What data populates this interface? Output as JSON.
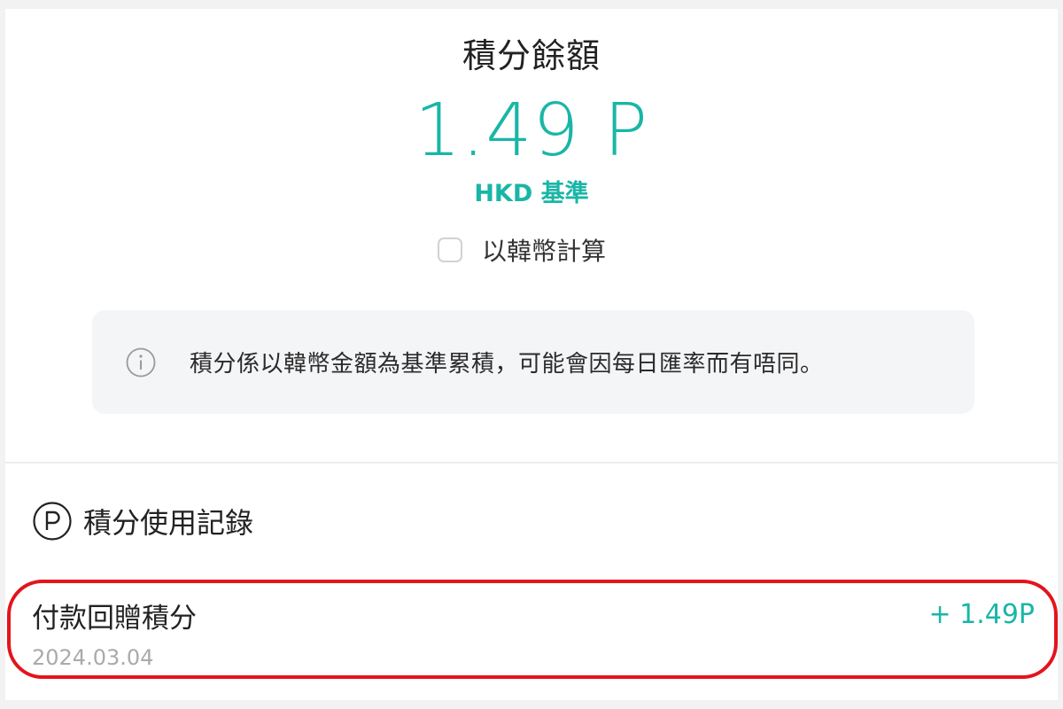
{
  "balance": {
    "title": "積分餘額",
    "amount": "1.49 P",
    "basis": "HKD 基準",
    "krw_toggle_label": "以韓幣計算",
    "krw_toggle_checked": false
  },
  "notice": {
    "icon": "info-icon",
    "text": "積分係以韓幣金額為基準累積，可能會因每日匯率而有唔同。"
  },
  "history": {
    "icon": "points-p-icon",
    "label": "積分使用記錄",
    "records": [
      {
        "title": "付款回贈積分",
        "amount": "+ 1.49P",
        "date": "2024.03.04"
      }
    ]
  },
  "colors": {
    "accent": "#19b6a6",
    "highlight": "#e3141c",
    "notice_bg": "#f4f5f7"
  }
}
